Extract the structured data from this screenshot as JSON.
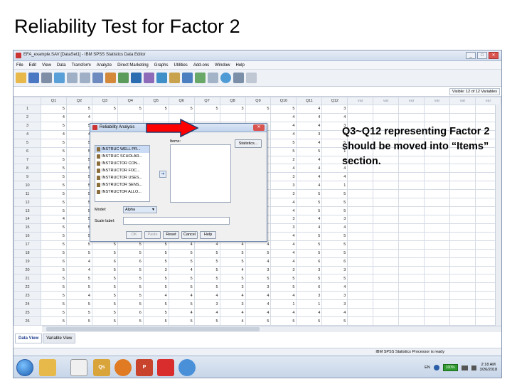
{
  "slide": {
    "title": "Reliability Test for Factor 2",
    "callout": "Q3~Q12 representing Factor 2 should be moved into “Items” section."
  },
  "window": {
    "title": "EFA_example.SAV [DataSet1] - IBM SPSS Statistics Data Editor",
    "controls": [
      "_",
      "□",
      "✕"
    ]
  },
  "menu": [
    "File",
    "Edit",
    "View",
    "Data",
    "Transform",
    "Analyze",
    "Direct Marketing",
    "Graphs",
    "Utilities",
    "Add-ons",
    "Window",
    "Help"
  ],
  "visible_info": "Visible: 12 of 12 Variables",
  "grid": {
    "columns": [
      "Q1",
      "Q2",
      "Q3",
      "Q4",
      "Q5",
      "Q6",
      "Q7",
      "Q8",
      "Q9",
      "Q10",
      "Q11",
      "Q12",
      "var",
      "var",
      "var",
      "var",
      "var",
      "var"
    ],
    "rows": [
      {
        "n": "1",
        "v": [
          "5",
          "5",
          "5",
          "5",
          "5",
          "5",
          "5",
          "3",
          "5",
          "5",
          "4",
          "3"
        ]
      },
      {
        "n": "2",
        "v": [
          "4",
          "4",
          "",
          "",
          "",
          "",
          "",
          "",
          "",
          "4",
          "4",
          "4"
        ]
      },
      {
        "n": "3",
        "v": [
          "5",
          "5",
          "",
          "",
          "",
          "",
          "",
          "",
          "",
          "4",
          "4",
          "3"
        ]
      },
      {
        "n": "4",
        "v": [
          "4",
          "4",
          "",
          "",
          "",
          "",
          "",
          "",
          "",
          "4",
          "3",
          "3"
        ]
      },
      {
        "n": "5",
        "v": [
          "5",
          "5",
          "",
          "",
          "",
          "",
          "",
          "",
          "",
          "5",
          "4",
          "5"
        ]
      },
      {
        "n": "6",
        "v": [
          "5",
          "5",
          "",
          "",
          "",
          "",
          "",
          "",
          "",
          "5",
          "5",
          "1"
        ]
      },
      {
        "n": "7",
        "v": [
          "5",
          "5",
          "",
          "",
          "",
          "",
          "",
          "",
          "",
          "2",
          "4",
          "4"
        ]
      },
      {
        "n": "8",
        "v": [
          "5",
          "5",
          "",
          "",
          "",
          "",
          "",
          "",
          "",
          "4",
          "4",
          "4"
        ]
      },
      {
        "n": "9",
        "v": [
          "5",
          "5",
          "",
          "",
          "",
          "",
          "",
          "",
          "",
          "3",
          "4",
          "4"
        ]
      },
      {
        "n": "10",
        "v": [
          "5",
          "5",
          "",
          "",
          "",
          "",
          "",
          "",
          "",
          "3",
          "4",
          "1"
        ]
      },
      {
        "n": "11",
        "v": [
          "5",
          "5",
          "",
          "",
          "",
          "",
          "",
          "",
          "",
          "3",
          "5",
          "5"
        ]
      },
      {
        "n": "12",
        "v": [
          "5",
          "5",
          "",
          "",
          "",
          "",
          "",
          "",
          "",
          "4",
          "5",
          "5"
        ]
      },
      {
        "n": "13",
        "v": [
          "5",
          "5",
          "",
          "",
          "",
          "",
          "",
          "",
          "",
          "4",
          "5",
          "5"
        ]
      },
      {
        "n": "14",
        "v": [
          "4",
          "5",
          "",
          "",
          "",
          "",
          "",
          "",
          "",
          "3",
          "4",
          "3"
        ]
      },
      {
        "n": "15",
        "v": [
          "5",
          "5",
          "",
          "",
          "",
          "",
          "",
          "",
          "",
          "3",
          "4",
          "4"
        ]
      },
      {
        "n": "16",
        "v": [
          "5",
          "5",
          "",
          "",
          "",
          "",
          "",
          "",
          "",
          "4",
          "5",
          "5"
        ]
      },
      {
        "n": "17",
        "v": [
          "5",
          "5",
          "5",
          "5",
          "5",
          "4",
          "4",
          "4",
          "4",
          "4",
          "5",
          "5"
        ]
      },
      {
        "n": "18",
        "v": [
          "5",
          "5",
          "5",
          "5",
          "5",
          "5",
          "5",
          "5",
          "5",
          "4",
          "5",
          "5"
        ]
      },
      {
        "n": "19",
        "v": [
          "6",
          "4",
          "6",
          "6",
          "5",
          "5",
          "5",
          "5",
          "4",
          "4",
          "6",
          "6"
        ]
      },
      {
        "n": "20",
        "v": [
          "5",
          "4",
          "5",
          "5",
          "3",
          "4",
          "5",
          "4",
          "3",
          "3",
          "3",
          "3"
        ]
      },
      {
        "n": "21",
        "v": [
          "5",
          "5",
          "5",
          "5",
          "5",
          "5",
          "5",
          "5",
          "5",
          "5",
          "5",
          "5"
        ]
      },
      {
        "n": "22",
        "v": [
          "5",
          "5",
          "5",
          "5",
          "5",
          "5",
          "5",
          "3",
          "3",
          "5",
          "6",
          "4"
        ]
      },
      {
        "n": "23",
        "v": [
          "5",
          "4",
          "5",
          "5",
          "4",
          "4",
          "4",
          "4",
          "4",
          "4",
          "3",
          "3"
        ]
      },
      {
        "n": "24",
        "v": [
          "5",
          "5",
          "5",
          "5",
          "5",
          "5",
          "3",
          "3",
          "4",
          "1",
          "1",
          "3"
        ]
      },
      {
        "n": "25",
        "v": [
          "5",
          "5",
          "5",
          "6",
          "5",
          "4",
          "4",
          "4",
          "4",
          "4",
          "4",
          "4"
        ]
      },
      {
        "n": "26",
        "v": [
          "5",
          "5",
          "5",
          "5",
          "5",
          "5",
          "5",
          "4",
          "5",
          "5",
          "5",
          "5"
        ]
      }
    ]
  },
  "tabs": [
    "Data View",
    "Variable View"
  ],
  "status": "IBM SPSS Statistics Processor is ready",
  "dialog": {
    "title": "Reliability Analysis",
    "close": "✕",
    "items_label": "Items:",
    "statistics_button": "Statistics...",
    "variables": [
      "INSTRUC WELL PR...",
      "INSTRUC SCHOLAR...",
      "INSTRUCTOR CON...",
      "INSTRUCTOR FOC...",
      "INSTRUCTOR USES...",
      "INSTRUCTOR SENS...",
      "INSTRUCTOR ALLO..."
    ],
    "move_arrow": "➔",
    "model_label": "Model:",
    "model_value": "Alpha",
    "scale_label": "Scale label:",
    "buttons": [
      "OK",
      "Paste",
      "Reset",
      "Cancel",
      "Help"
    ]
  },
  "taskbar": {
    "apps": [
      "Qs",
      "P"
    ],
    "locale": "EN",
    "battery": "100%",
    "time": "2:18 AM",
    "date": "3/26/2018"
  },
  "colors": {
    "arrow_fill": "#ff0000",
    "arrow_stroke": "#1f3a6e",
    "window_chrome": "#cfdbec"
  }
}
